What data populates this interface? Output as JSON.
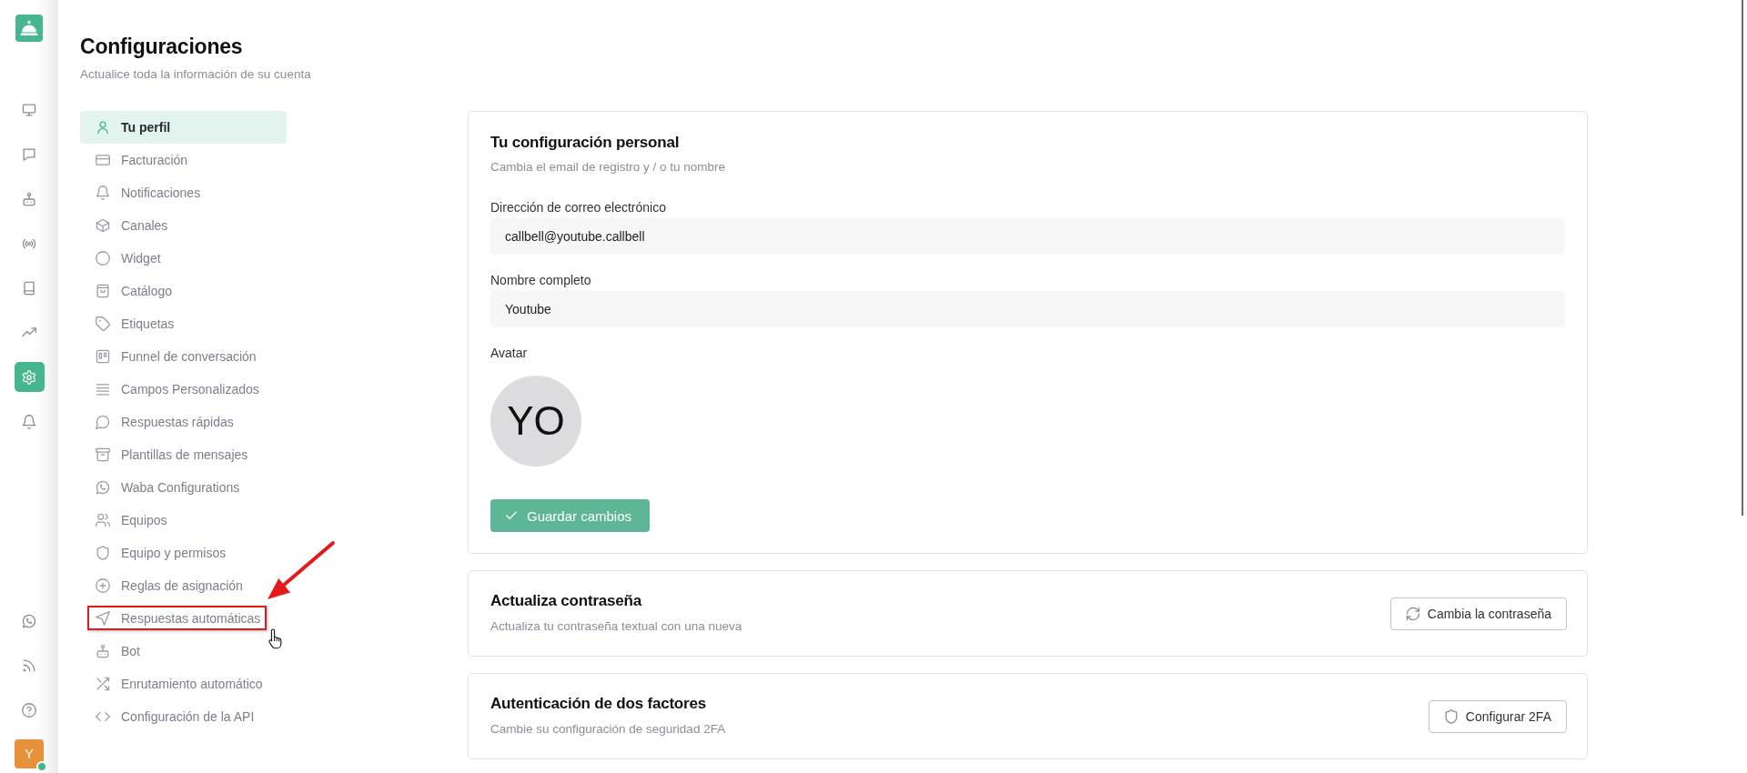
{
  "rail": {
    "top_items": [
      {
        "selected": false
      },
      {
        "selected": false
      },
      {
        "selected": false
      },
      {
        "selected": false
      },
      {
        "selected": false
      },
      {
        "selected": false
      },
      {
        "selected": true
      },
      {
        "selected": false
      }
    ],
    "bottom_items": [
      {
        "selected": false
      },
      {
        "selected": false
      },
      {
        "selected": false
      }
    ],
    "user": {
      "initial": "Y",
      "online": true
    }
  },
  "page": {
    "title": "Configuraciones",
    "subtitle": "Actualice toda la información de su cuenta"
  },
  "settings_nav": {
    "items": [
      {
        "label": "Tu perfil",
        "selected": true,
        "highlighted": false
      },
      {
        "label": "Facturación",
        "selected": false,
        "highlighted": false
      },
      {
        "label": "Notificaciones",
        "selected": false,
        "highlighted": false
      },
      {
        "label": "Canales",
        "selected": false,
        "highlighted": false
      },
      {
        "label": "Widget",
        "selected": false,
        "highlighted": false
      },
      {
        "label": "Catálogo",
        "selected": false,
        "highlighted": false
      },
      {
        "label": "Etiquetas",
        "selected": false,
        "highlighted": false
      },
      {
        "label": "Funnel de conversación",
        "selected": false,
        "highlighted": false
      },
      {
        "label": "Campos Personalizados",
        "selected": false,
        "highlighted": false
      },
      {
        "label": "Respuestas rápidas",
        "selected": false,
        "highlighted": false
      },
      {
        "label": "Plantillas de mensajes",
        "selected": false,
        "highlighted": false
      },
      {
        "label": "Waba Configurations",
        "selected": false,
        "highlighted": false
      },
      {
        "label": "Equipos",
        "selected": false,
        "highlighted": false
      },
      {
        "label": "Equipo y permisos",
        "selected": false,
        "highlighted": false
      },
      {
        "label": "Reglas de asignación",
        "selected": false,
        "highlighted": false
      },
      {
        "label": "Respuestas automáticas",
        "selected": false,
        "highlighted": true
      },
      {
        "label": "Bot",
        "selected": false,
        "highlighted": false
      },
      {
        "label": "Enrutamiento automático",
        "selected": false,
        "highlighted": false
      },
      {
        "label": "Configuración de la API",
        "selected": false,
        "highlighted": false
      }
    ]
  },
  "profile_card": {
    "title": "Tu configuración personal",
    "subtitle": "Cambia el email de registro y / o tu nombre",
    "fields": [
      {
        "label": "Dirección de correo electrónico",
        "value": "callbell@youtube.callbell"
      },
      {
        "label": "Nombre completo",
        "value": "Youtube"
      }
    ],
    "avatar": {
      "label": "Avatar",
      "initials": "YO"
    },
    "save_button": {
      "label": "Guardar cambios",
      "disabled": true
    }
  },
  "password_card": {
    "title": "Actualiza contraseña",
    "subtitle": "Actualiza tu contraseña textual con una nueva",
    "button": "Cambia la contraseña"
  },
  "two_factor_card": {
    "title": "Autenticación de dos factores",
    "subtitle": "Cambie su configuración de seguridad 2FA",
    "button": "Configurar 2FA"
  }
}
